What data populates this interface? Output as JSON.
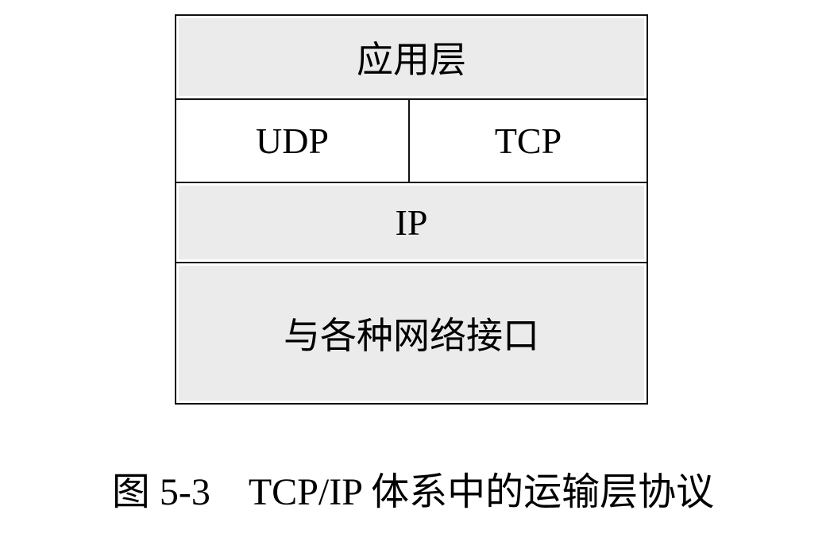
{
  "diagram": {
    "layers": {
      "application": "应用层",
      "udp": "UDP",
      "tcp": "TCP",
      "ip": "IP",
      "network_interface": "与各种网络接口"
    },
    "colors": {
      "layer_fill": "#ebebeb",
      "border": "#111111"
    }
  },
  "caption": {
    "number": "图 5-3",
    "title": "TCP/IP 体系中的运输层协议"
  }
}
